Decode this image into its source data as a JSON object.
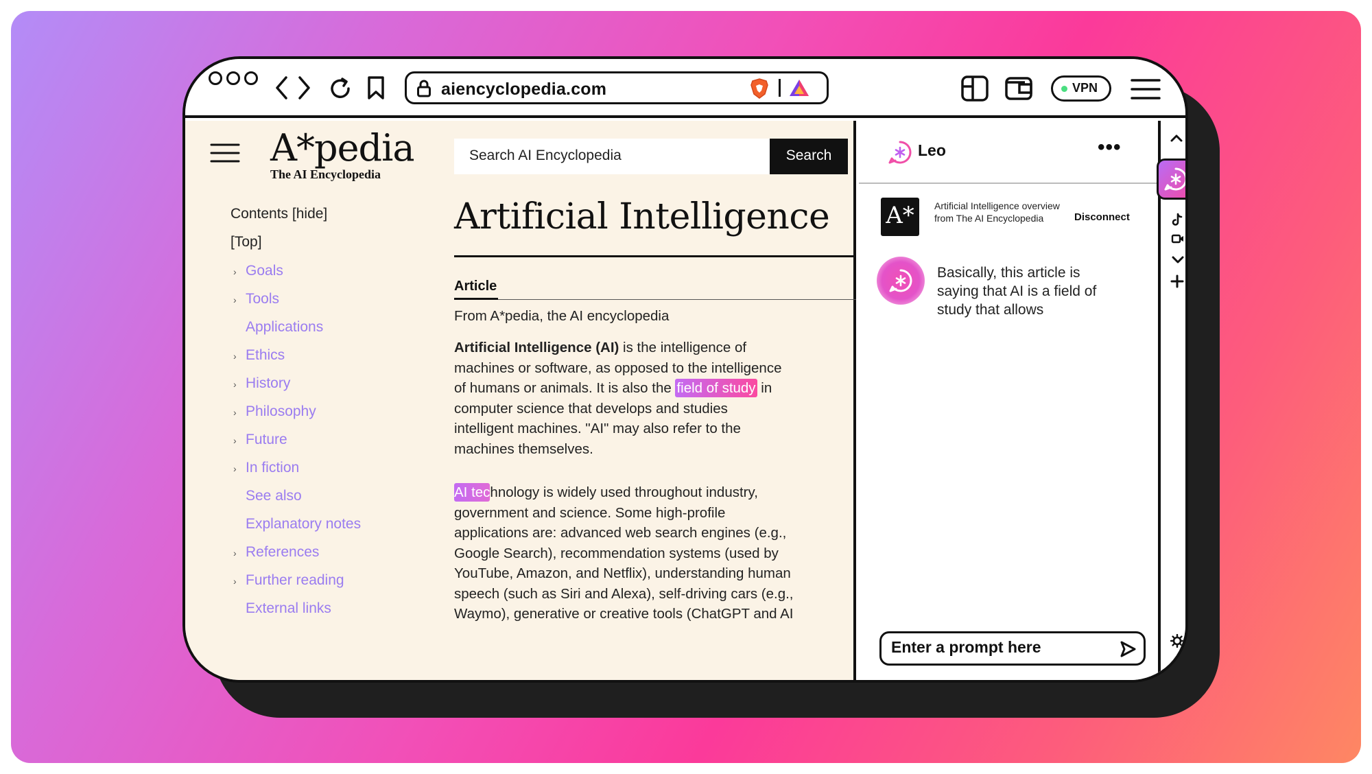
{
  "browser": {
    "url": "aiencyclopedia.com",
    "vpn_label": "VPN"
  },
  "site": {
    "logo_title": "A*pedia",
    "logo_subtitle": "The AI Encyclopedia",
    "search_placeholder": "Search AI Encyclopedia",
    "search_button": "Search"
  },
  "toc": {
    "contents_label": "Contents [hide]",
    "top_label": "[Top]",
    "items": [
      {
        "label": "Goals",
        "has_chevron": true
      },
      {
        "label": "Tools",
        "has_chevron": true
      },
      {
        "label": "Applications",
        "has_chevron": false
      },
      {
        "label": "Ethics",
        "has_chevron": true
      },
      {
        "label": "History",
        "has_chevron": true
      },
      {
        "label": "Philosophy",
        "has_chevron": true
      },
      {
        "label": "Future",
        "has_chevron": true
      },
      {
        "label": "In fiction",
        "has_chevron": true
      },
      {
        "label": "See also",
        "has_chevron": false
      },
      {
        "label": "Explanatory notes",
        "has_chevron": false
      },
      {
        "label": "References",
        "has_chevron": true
      },
      {
        "label": "Further reading",
        "has_chevron": true
      },
      {
        "label": "External links",
        "has_chevron": false
      }
    ]
  },
  "article": {
    "title": "Artificial Intelligence",
    "tab": "Article",
    "from_line": "From A*pedia, the AI encyclopedia",
    "p1_term": "Artificial Intelligence (AI)",
    "p1_l1": " is the intelligence of",
    "p1_l2": "machines or software, as opposed to the intelligence",
    "p1_l3a": "of humans or animals. It is also the ",
    "p1_highlight": "field of study",
    "p1_l3b": " in",
    "p1_l4": "computer science that develops and studies",
    "p1_l5": "intelligent machines. \"AI\" may also refer to the",
    "p1_l6": "machines themselves.",
    "p2_highlight": "AI tec",
    "p2_l1": "hnology is widely used throughout industry,",
    "p2_l2": "government and science. Some high-profile",
    "p2_l3": "applications are: advanced web search engines (e.g.,",
    "p2_l4": "Google Search), recommendation systems (used by",
    "p2_l5": "YouTube, Amazon, and Netflix), understanding human",
    "p2_l6": "speech (such as Siri and Alexa), self-driving cars (e.g.,",
    "p2_l7": "Waymo), generative or creative tools (ChatGPT and AI"
  },
  "leo": {
    "name": "Leo",
    "more": "•••",
    "context_logo": "A*",
    "context_text": "Artificial Intelligence overview from The AI Encyclopedia",
    "disconnect": "Disconnect",
    "message": "Basically, this article is saying that AI is a field of study that allows",
    "prompt_placeholder": "Enter a prompt here"
  },
  "colors": {
    "page_bg": "#fbf3e6",
    "link": "#9a7cf0",
    "accent_gradient_start": "#c36bf2",
    "accent_gradient_end": "#fb4aa0"
  }
}
